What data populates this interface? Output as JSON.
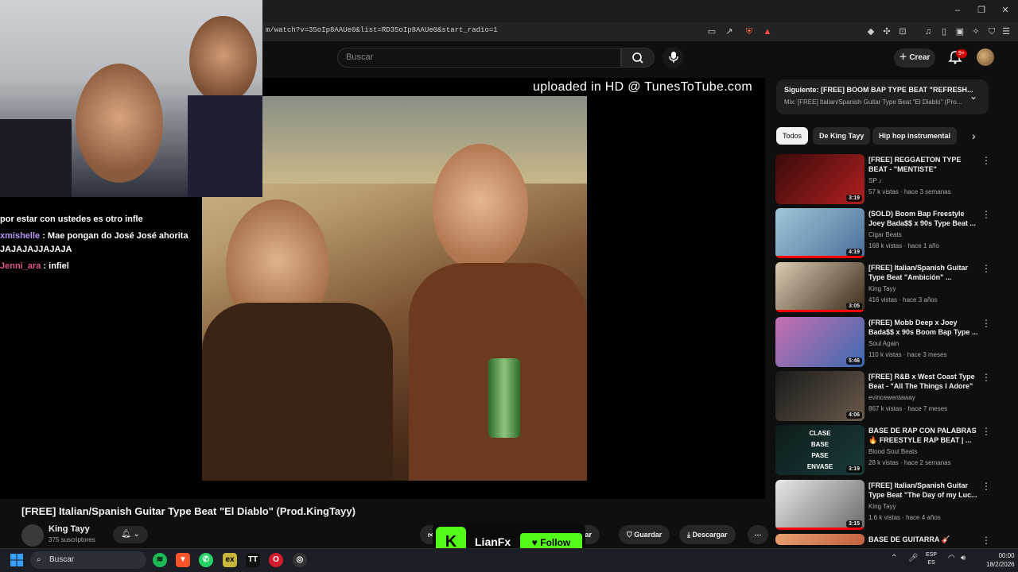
{
  "browser": {
    "url": "m/watch?v=35oIp8AAUe0&list=RD35oIp8AAUe0&start_radio=1"
  },
  "youtube": {
    "search_placeholder": "Buscar",
    "create_label": "Crear",
    "notif_count": "9+"
  },
  "player": {
    "watermark": "uploaded in HD @ TunesToTube.com"
  },
  "stream": {
    "chat": [
      {
        "user": "",
        "text": "por estar con ustedes es otro infle"
      },
      {
        "user": "xmishelle",
        "text": " : Mae pongan do José José ahorita JAJAJAJJAJAJA"
      },
      {
        "user": "Jenni_ara",
        "text": " : infiel"
      }
    ],
    "kick_name": "LianFx",
    "kick_follow": "Follow",
    "kick_logo": "K"
  },
  "video": {
    "title": "[FREE] Italian/Spanish Guitar Type Beat \"El Diablo\" (Prod.KingTayy)",
    "channel": "King Tayy",
    "subs": "375 suscriptores",
    "ask_label": "guntar",
    "save_label": "Guardar",
    "download_label": "Descargar"
  },
  "sidebar": {
    "upnext_title": "Siguiente: [FREE] BOOM BAP TYPE BEAT \"REFRESH...",
    "upnext_sub": "Mix: [FREE] Italian/Spanish Guitar Type Beat \"El Diablo\" (Pro...",
    "chips": [
      "Todos",
      "De King Tayy",
      "Hip hop instrumental"
    ],
    "videos": [
      {
        "title": "[FREE] REGGAETON TYPE BEAT - \"MENTISTE\"",
        "channel": "SP ♪",
        "meta": "57 k vistas · hace 3 semanas",
        "duration": "3:19",
        "color1": "#3a0a0a",
        "color2": "#b02020",
        "progress": 0
      },
      {
        "title": "(SOLD) Boom Bap Freestyle Joey Bada$$ x 90s Type Beat ...",
        "channel": "Cigar Beats",
        "meta": "168 k vistas · hace 1 año",
        "duration": "4:19",
        "color1": "#9fc7d8",
        "color2": "#4b6f9a",
        "progress": 1
      },
      {
        "title": "[FREE] Italian/Spanish Guitar Type Beat \"Ambición\" ...",
        "channel": "King Tayy",
        "meta": "416 vistas · hace 3 años",
        "duration": "3:05",
        "color1": "#d9cdb4",
        "color2": "#3a2a1a",
        "progress": 1
      },
      {
        "title": "(FREE) Mobb Deep x Joey Bada$$ x 90s Boom Bap Type ...",
        "channel": "Soul Again",
        "meta": "110 k vistas · hace 3 meses",
        "duration": "5:46",
        "color1": "#c86fb0",
        "color2": "#3a6ab0",
        "progress": 0
      },
      {
        "title": "[FREE] R&B x West Coast Type Beat - \"All The Things I Adore\"",
        "channel": "evincewentaway",
        "meta": "867 k vistas · hace 7 meses",
        "duration": "4:06",
        "color1": "#1a1a1a",
        "color2": "#6b5a4a",
        "progress": 0
      },
      {
        "title": "BASE DE RAP CON PALABRAS 🔥 FREESTYLE RAP BEAT | ...",
        "channel": "Blood Soul Beats",
        "meta": "28 k vistas · hace 2 semanas",
        "duration": "3:19",
        "color1": "#0d1c1c",
        "color2": "#1a3a3a",
        "progress": 0,
        "overlay": "CLASE\nBASE\nPASE\nENVASE"
      },
      {
        "title": "[FREE] Italian/Spanish Guitar Type Beat \"The Day of my Luc...",
        "channel": "King Tayy",
        "meta": "1.6 k vistas · hace 4 años",
        "duration": "3:15",
        "color1": "#e8e8e8",
        "color2": "#6a6a6a",
        "progress": 1
      },
      {
        "title": "BASE DE GUITARRA 🎸",
        "channel": "",
        "meta": "",
        "duration": "",
        "color1": "#e8a070",
        "color2": "#c06040",
        "progress": 0
      }
    ]
  },
  "taskbar": {
    "search": "Buscar",
    "lang1": "ESP",
    "lang2": "ES",
    "time": "00:00",
    "date": "18/2/2026"
  }
}
